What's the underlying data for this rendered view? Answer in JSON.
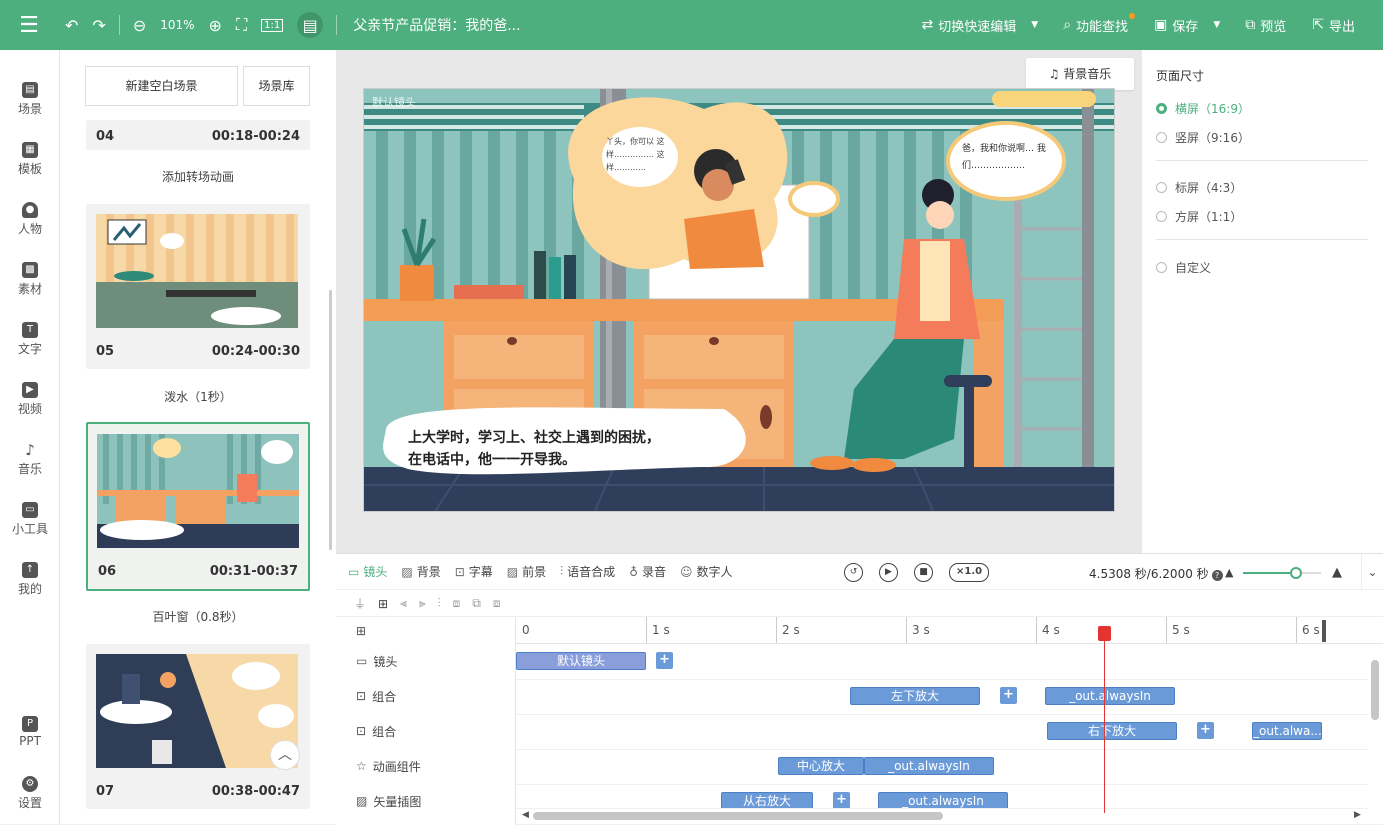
{
  "app": {
    "accent": "#4caf7d"
  },
  "toolbar": {
    "zoom": "101%",
    "doc_title": "父亲节产品促销：我的爸...",
    "switch_label": "切换快速编辑",
    "search_label": "功能查找",
    "save_label": "保存",
    "preview_label": "预览",
    "export_label": "导出"
  },
  "nav": [
    {
      "label": "场景",
      "icon": "scene-icon"
    },
    {
      "label": "模板",
      "icon": "template-icon"
    },
    {
      "label": "人物",
      "icon": "person-icon"
    },
    {
      "label": "素材",
      "icon": "material-icon"
    },
    {
      "label": "文字",
      "icon": "text-icon"
    },
    {
      "label": "视频",
      "icon": "video-icon"
    },
    {
      "label": "音乐",
      "icon": "music-icon"
    },
    {
      "label": "小工具",
      "icon": "toolbox-icon"
    },
    {
      "label": "我的",
      "icon": "my-icon"
    },
    {
      "label": "PPT",
      "icon": "ppt-icon"
    },
    {
      "label": "设置",
      "icon": "settings-icon"
    }
  ],
  "scene_panel": {
    "new_blank": "新建空白场景",
    "library": "场景库",
    "scenes": [
      {
        "num": "04",
        "time": "00:18-00:24"
      },
      {
        "num": "05",
        "time": "00:24-00:30"
      },
      {
        "num": "06",
        "time": "00:31-00:37"
      },
      {
        "num": "07",
        "time": "00:38-00:47"
      }
    ],
    "transitions": [
      "添加转场动画",
      "泼水（1秒）",
      "百叶窗（0.8秒）"
    ]
  },
  "canvas": {
    "music_label": "背景音乐",
    "stage_label": "默认镜头",
    "bubble_top_left": "丫头，你可以 这样…………… 这样…………",
    "bubble_right": "爸，我和你说啊… 我们………………",
    "caption_line1": "上大学时，学习上、社交上遇到的困扰，",
    "caption_line2": "在电话中，他一一开导我。"
  },
  "right_panel": {
    "title": "页面尺寸",
    "options": [
      "横屏（16:9）",
      "竖屏（9:16）",
      "标屏（4:3）",
      "方屏（1:1）",
      "自定义"
    ]
  },
  "timeline": {
    "tabs": [
      "镜头",
      "背景",
      "字幕",
      "前景",
      "语音合成",
      "录音",
      "数字人"
    ],
    "speed": "×1.0",
    "time_readout": "4.5308 秒/6.2000 秒",
    "zoom_level": 0.68,
    "ruler": [
      "0",
      "1 s",
      "2 s",
      "3 s",
      "4 s",
      "5 s",
      "6 s"
    ],
    "tracks": [
      "镜头",
      "组合",
      "组合",
      "动画组件",
      "矢量插图"
    ],
    "clips": {
      "camera": "默认镜头",
      "g1a": "左下放大",
      "g1b": "_out.alwaysIn",
      "g2a": "右下放大",
      "g2b": "_out.alwa...",
      "an_a": "中心放大",
      "an_b": "_out.alwaysIn",
      "vec_a": "从右放大",
      "vec_b": "_out.alwaysIn"
    }
  }
}
